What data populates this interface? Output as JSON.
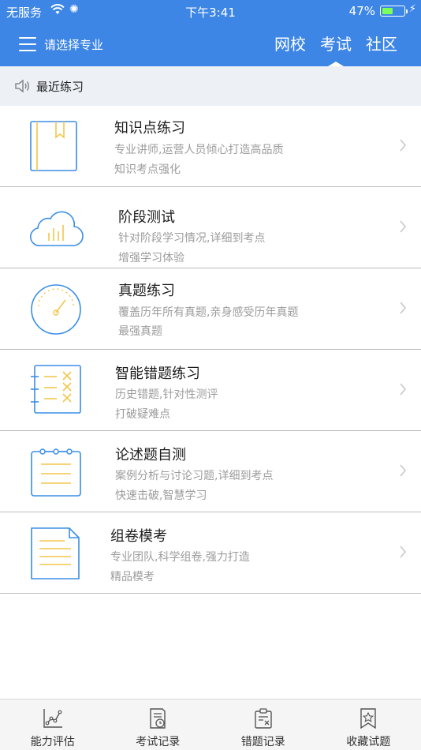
{
  "status_bar": {
    "carrier": "无服务",
    "time": "下午3:41",
    "battery": "47%",
    "battery_level": 0.47
  },
  "nav": {
    "menu_label": "请选择专业",
    "tabs": [
      {
        "label": "网校",
        "active": false
      },
      {
        "label": "考试",
        "active": true
      },
      {
        "label": "社区",
        "active": false
      }
    ]
  },
  "notice": {
    "text": "最近练习"
  },
  "items": [
    {
      "title": "知识点练习",
      "desc1": "专业讲师,运营人员倾心打造高品质",
      "desc2": "知识考点强化",
      "icon": "book-icon"
    },
    {
      "title": "阶段测试",
      "desc1": "针对阶段学习情况,详细到考点",
      "desc2": "增强学习体验",
      "icon": "cloud-chart-icon"
    },
    {
      "title": "真题练习",
      "desc1": "覆盖历年所有真题,亲身感受历年真题",
      "desc2": "最强真题",
      "icon": "gauge-icon"
    },
    {
      "title": "智能错题练习",
      "desc1": "历史错题,针对性测评",
      "desc2": "打破疑难点",
      "icon": "wrong-list-icon"
    },
    {
      "title": "论述题自测",
      "desc1": "案例分析与讨论习题,详细到考点",
      "desc2": "快速击破,智慧学习",
      "icon": "notepad-icon"
    },
    {
      "title": "组卷模考",
      "desc1": "专业团队,科学组卷,强力打造",
      "desc2": "精品模考",
      "icon": "document-icon"
    }
  ],
  "bottom_bar": [
    {
      "label": "能力评估",
      "icon": "line-chart-icon"
    },
    {
      "label": "考试记录",
      "icon": "exam-record-icon"
    },
    {
      "label": "错题记录",
      "icon": "wrong-record-icon"
    },
    {
      "label": "收藏试题",
      "icon": "bookmark-star-icon"
    }
  ],
  "colors": {
    "header": "#3d86e6",
    "icon_blue": "#3a8ee6",
    "icon_yellow": "#f3c64a"
  }
}
